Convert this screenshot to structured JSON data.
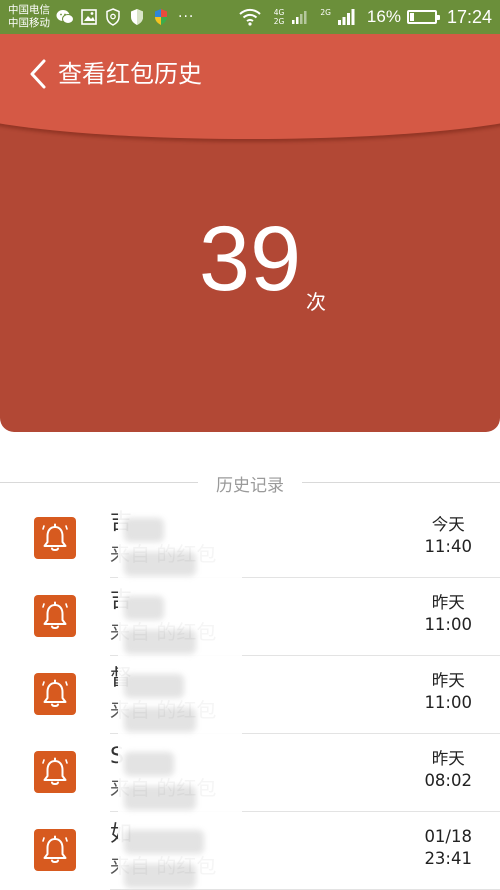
{
  "status_bar": {
    "carrier_1": "中国电信",
    "carrier_2": "中国移动",
    "network_1": "4G",
    "network_2": "2G",
    "network_3": "2G",
    "battery_percent": "16%",
    "battery_level": 0.16,
    "time": "17:24",
    "more_label": "···"
  },
  "header": {
    "title": "查看红包历史",
    "count": "39",
    "count_unit": "次"
  },
  "history": {
    "section_title": "历史记录",
    "records": [
      {
        "sender": "吉",
        "description": "来自 的红包",
        "day": "今天",
        "time": "11:40"
      },
      {
        "sender": "吉",
        "description": "来自 的红包",
        "day": "昨天",
        "time": "11:00"
      },
      {
        "sender": "督",
        "description": "来自 的红包",
        "day": "昨天",
        "time": "11:00"
      },
      {
        "sender": "S",
        "description": "来自 的红包",
        "day": "昨天",
        "time": "08:02"
      },
      {
        "sender": "如",
        "description": "来自 的红包",
        "day": "01/18",
        "time": "23:41"
      }
    ]
  },
  "colors": {
    "status_bar_bg": "#6b8f3a",
    "header_flap": "#d55945",
    "header_body": "#b24835",
    "icon_bg": "#d75a1f"
  }
}
